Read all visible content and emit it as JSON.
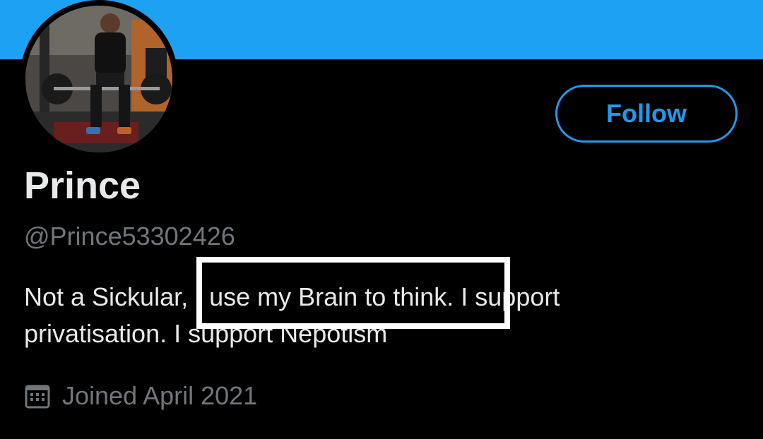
{
  "colors": {
    "banner": "#1da1f2",
    "accent": "#1d9bf0",
    "background": "#000000",
    "primary_text": "#e7e9ea",
    "secondary_text": "#71767b",
    "highlight_box": "#ffffff"
  },
  "profile": {
    "display_name": "Prince",
    "handle": "@Prince53302426",
    "bio": {
      "before": "Not a Sickular, ",
      "highlighted": "I use my Brain to think.",
      "after": " I support privatisation. I support Nepotism"
    },
    "joined": {
      "icon": "calendar-icon",
      "text": "Joined April 2021"
    },
    "avatar": {
      "icon": "profile-photo"
    }
  },
  "actions": {
    "follow_label": "Follow"
  }
}
